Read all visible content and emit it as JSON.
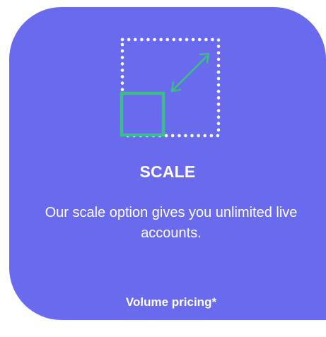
{
  "card": {
    "icon": "scale-up-icon",
    "title": "SCALE",
    "description": "Our scale option gives you unlimited live accounts.",
    "pricing_label": "Volume pricing*"
  },
  "colors": {
    "card_background": "#6a6aee",
    "text": "#ffffff",
    "accent": "#3dbd8c",
    "dotted_outline": "#ffffff"
  }
}
